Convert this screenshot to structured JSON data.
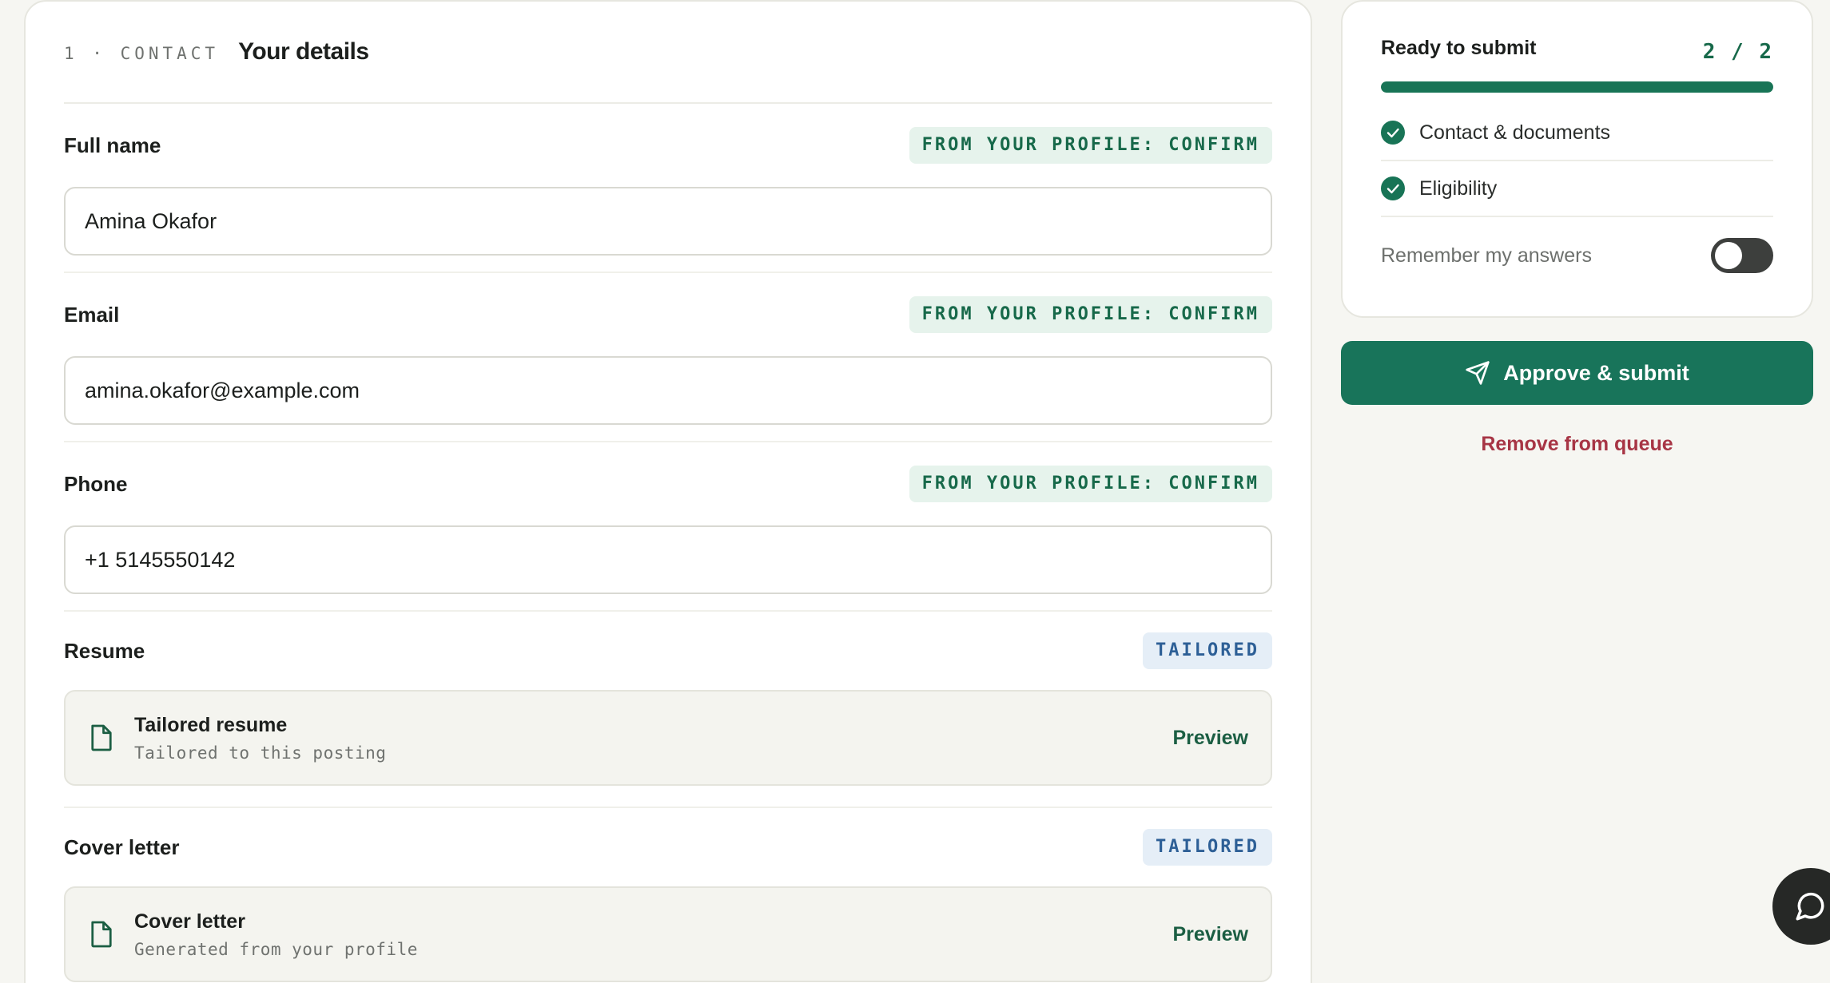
{
  "section": {
    "step": "1 · CONTACT",
    "title": "Your details"
  },
  "fields": {
    "full_name": {
      "label": "Full name",
      "badge": "FROM YOUR PROFILE: CONFIRM",
      "value": "Amina Okafor"
    },
    "email": {
      "label": "Email",
      "badge": "FROM YOUR PROFILE: CONFIRM",
      "value": "amina.okafor@example.com"
    },
    "phone": {
      "label": "Phone",
      "badge": "FROM YOUR PROFILE: CONFIRM",
      "value": "+1 5145550142"
    }
  },
  "documents": {
    "resume": {
      "label": "Resume",
      "badge": "TAILORED",
      "title": "Tailored resume",
      "subtitle": "Tailored to this posting",
      "action": "Preview",
      "icon": "document-icon"
    },
    "cover_letter": {
      "label": "Cover letter",
      "badge": "TAILORED",
      "title": "Cover letter",
      "subtitle": "Generated from your profile",
      "action": "Preview",
      "icon": "document-icon"
    }
  },
  "status": {
    "title": "Ready to submit",
    "count": "2 / 2",
    "progress": 1.0,
    "checks": [
      {
        "label": "Contact & documents",
        "done": true
      },
      {
        "label": "Eligibility",
        "done": true
      }
    ],
    "remember_label": "Remember my answers",
    "remember_on": false
  },
  "actions": {
    "approve_label": "Approve & submit",
    "remove_label": "Remove from queue"
  },
  "colors": {
    "accent": "#18745a",
    "danger": "#a73545",
    "profile_badge_bg": "#e6f3ec",
    "tailored_badge_bg": "#e5eef7"
  },
  "icons": {
    "send": "send-icon",
    "check": "check-circle-icon",
    "chat": "chat-bubble-icon"
  }
}
